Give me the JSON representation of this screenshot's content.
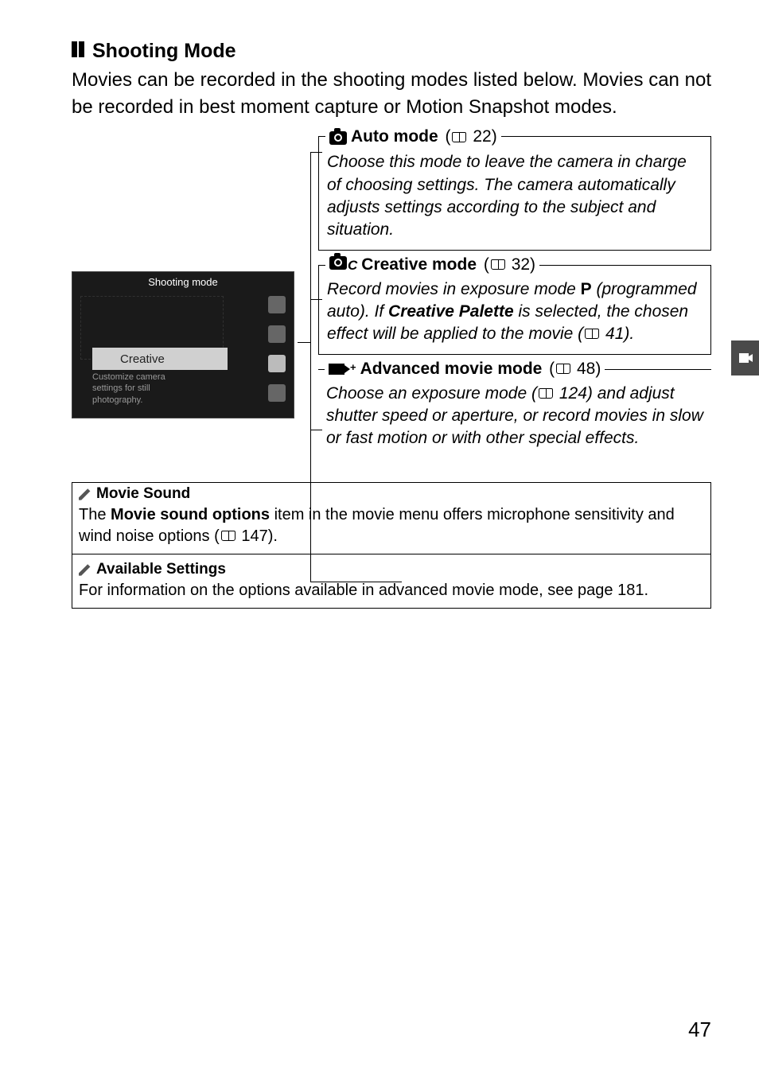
{
  "section": {
    "title": "Shooting Mode",
    "intro": "Movies can be recorded in the shooting modes listed below. Movies can not be recorded in best moment capture or Motion Snapshot modes."
  },
  "screenshot": {
    "header": "Shooting mode",
    "label": "Creative",
    "sublabel1": "Customize camera",
    "sublabel2": "settings for still",
    "sublabel3": "photography."
  },
  "modes": {
    "auto": {
      "icon_name": "camera-icon",
      "title_bold": "Auto mode",
      "page_ref": "22",
      "body": "Choose this mode to leave the camera in charge of choosing settings. The camera automatically adjusts settings according to the subject and situation."
    },
    "creative": {
      "icon_name": "camera-c-icon",
      "title_bold": "Creative mode",
      "page_ref": "32",
      "body_pre": "Record movies in exposure mode ",
      "body_p": "P",
      "body_mid": " (programmed auto). If ",
      "body_bold": "Creative Palette",
      "body_post": " is selected, the chosen effect will be applied to the movie (",
      "inner_ref": "41",
      "body_end": ")."
    },
    "advanced": {
      "icon_name": "movie-plus-icon",
      "title_bold": "Advanced movie mode",
      "page_ref": "48",
      "body_pre": "Choose an exposure mode (",
      "inner_ref": "124",
      "body_post": ") and adjust shutter speed or aperture, or record movies in slow or fast motion or with other special effects."
    }
  },
  "notes": {
    "sound": {
      "title": "Movie Sound",
      "body_pre": "The ",
      "body_bold": "Movie sound options",
      "body_mid": " item in the movie menu offers microphone sensitivity and wind noise options (",
      "ref": "147",
      "body_end": ")."
    },
    "settings": {
      "title": "Available Settings",
      "body": "For information on the options available in advanced movie mode, see page 181."
    }
  },
  "page_number": "47"
}
